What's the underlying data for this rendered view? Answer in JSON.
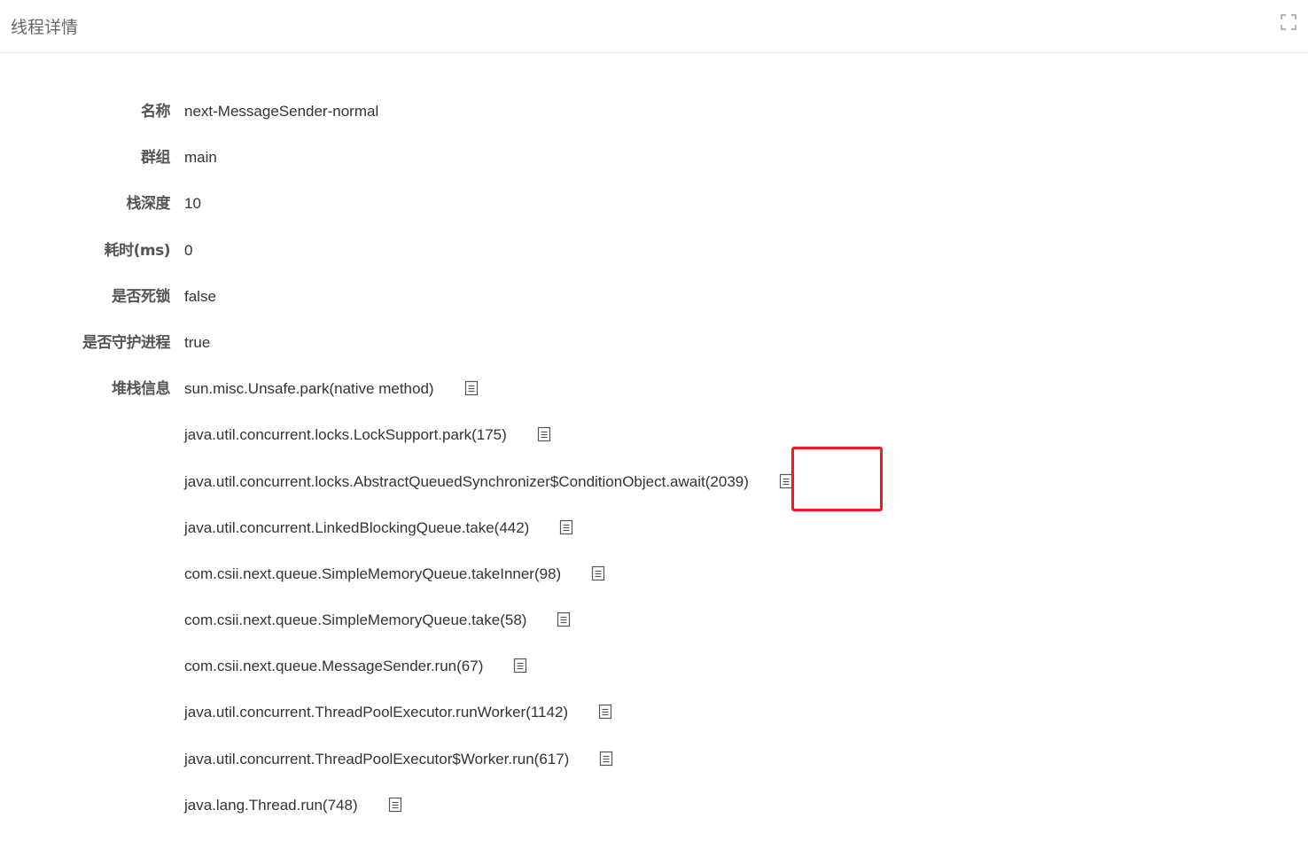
{
  "header": {
    "title": "线程详情"
  },
  "fields": [
    {
      "label": "名称",
      "value": "next-MessageSender-normal"
    },
    {
      "label": "群组",
      "value": "main"
    },
    {
      "label": "栈深度",
      "value": "10"
    },
    {
      "label": "耗时(ms)",
      "value": "0"
    },
    {
      "label": "是否死锁",
      "value": "false"
    },
    {
      "label": "是否守护进程",
      "value": "true"
    }
  ],
  "stack": {
    "label": "堆栈信息",
    "frames": [
      "sun.misc.Unsafe.park(native method)",
      "java.util.concurrent.locks.LockSupport.park(175)",
      "java.util.concurrent.locks.AbstractQueuedSynchronizer$ConditionObject.await(2039)",
      "java.util.concurrent.LinkedBlockingQueue.take(442)",
      "com.csii.next.queue.SimpleMemoryQueue.takeInner(98)",
      "com.csii.next.queue.SimpleMemoryQueue.take(58)",
      "com.csii.next.queue.MessageSender.run(67)",
      "java.util.concurrent.ThreadPoolExecutor.runWorker(1142)",
      "java.util.concurrent.ThreadPoolExecutor$Worker.run(617)",
      "java.lang.Thread.run(748)"
    ],
    "frame_icon": "document-icon"
  },
  "colors": {
    "highlight": "#f21b1b",
    "label": "#555555",
    "value": "#333333",
    "title": "#666666"
  }
}
